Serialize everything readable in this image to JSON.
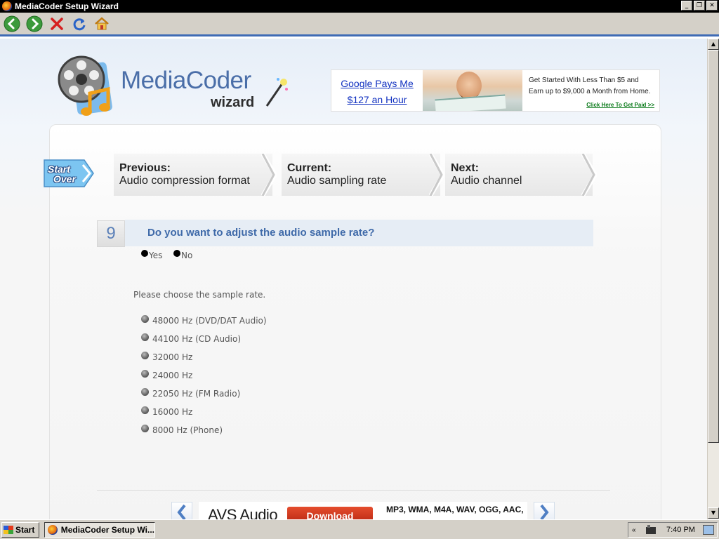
{
  "window": {
    "title": "MediaCoder Setup Wizard",
    "min_glyph": "_",
    "max_glyph": "❐",
    "close_glyph": "✕"
  },
  "toolbar": {
    "icons": [
      "back-icon",
      "forward-icon",
      "stop-icon",
      "refresh-icon",
      "home-icon"
    ]
  },
  "logo": {
    "brand": "MediaCoder",
    "sub": "wizard"
  },
  "ad": {
    "headline_1": "Google Pays Me",
    "headline_2": "$127 an Hour",
    "body_1": "Get Started With Less Than $5 and",
    "body_2": "Earn up to $9,000 a Month from Home.",
    "cta": "Click Here To Get Paid >>"
  },
  "start_over": {
    "line1": "Start",
    "line2": "Over"
  },
  "steps": {
    "previous": {
      "head": "Previous:",
      "value": "Audio compression format"
    },
    "current": {
      "head": "Current:",
      "value": "Audio sampling rate"
    },
    "next": {
      "head": "Next:",
      "value": "Audio channel"
    }
  },
  "question": {
    "number": "9",
    "text": "Do you want to adjust the audio sample rate?",
    "yes": "Yes",
    "no": "No",
    "prompt": "Please choose the sample rate."
  },
  "rates": [
    "48000 Hz (DVD/DAT Audio)",
    "44100 Hz (CD Audio)",
    "32000 Hz",
    "24000 Hz",
    "22050 Hz (FM Radio)",
    "16000 Hz",
    "8000 Hz (Phone)"
  ],
  "bottom_ad": {
    "product": "AVS Audio",
    "button": "Download",
    "formats": "MP3, WMA, M4A, WAV, OGG, AAC,"
  },
  "taskbar": {
    "start": "Start",
    "task": "MediaCoder Setup Wi...",
    "clock": "7:40 PM",
    "tray_chevron": "«"
  },
  "colors": {
    "accent": "#3f6aa9",
    "question_bg": "#e6edf5",
    "brand_blue": "#4a6ea8"
  }
}
